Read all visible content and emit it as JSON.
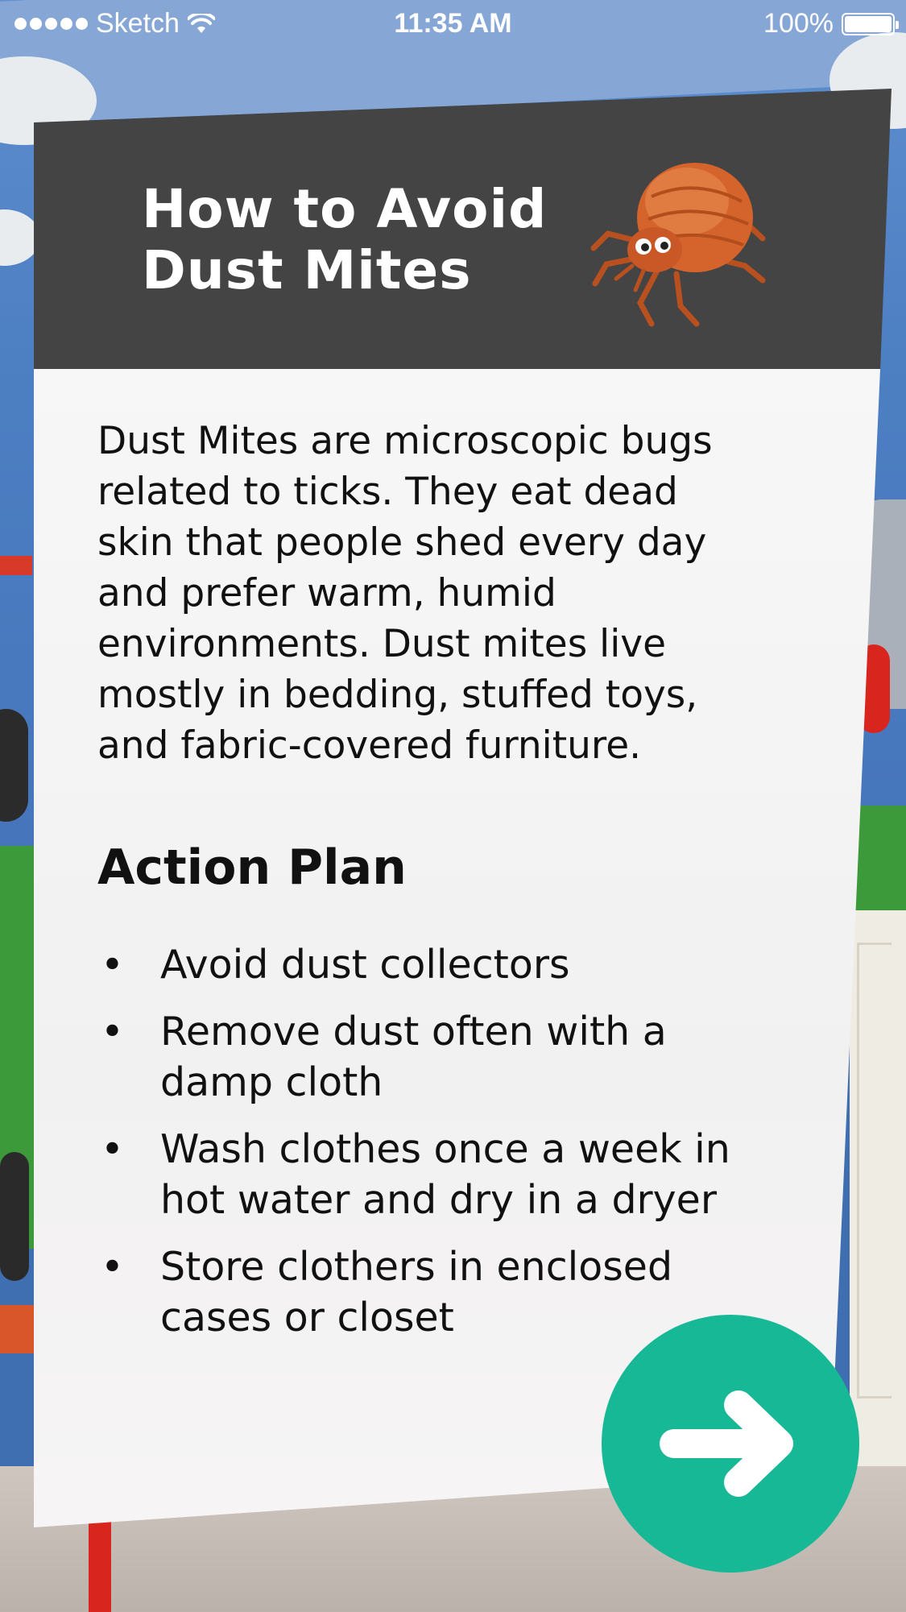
{
  "status_bar": {
    "carrier": "Sketch",
    "time": "11:35 AM",
    "battery_percent": "100%",
    "battery_level": 1.0
  },
  "card": {
    "title_line1": "How to Avoid",
    "title_line2": "Dust Mites",
    "header_color": "#444444",
    "description_lines": [
      "Dust Mites are microscopic bugs",
      "related to ticks. They eat dead",
      "skin that people shed every day",
      "and prefer warm, humid",
      "environments. Dust mites live",
      "mostly in bedding, stuffed toys,",
      "and fabric-covered furniture."
    ],
    "action_heading": "Action Plan",
    "action_items": [
      {
        "line1": "Avoid dust collectors",
        "line2": ""
      },
      {
        "line1": "Remove dust often with a",
        "line2": "damp cloth"
      },
      {
        "line1": "Wash clothes once a week in",
        "line2": "hot water and dry in a dryer"
      },
      {
        "line1": "Store clothers in enclosed",
        "line2": "cases or closet"
      }
    ],
    "bullet": "•"
  },
  "next_button": {
    "icon": "arrow-right-icon",
    "color": "#17b895"
  },
  "icons": [
    "wifi-icon",
    "battery-icon",
    "dust-mite-icon",
    "arrow-right-icon"
  ]
}
